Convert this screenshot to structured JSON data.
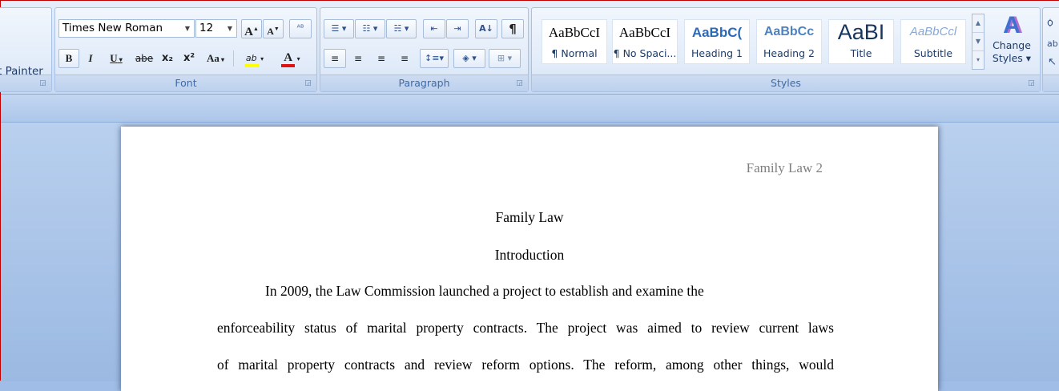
{
  "clipboard": {
    "format_painter_label": "t Painter"
  },
  "font": {
    "group_label": "Font",
    "font_name": "Times New Roman",
    "font_size": "12",
    "grow_label": "A",
    "shrink_label": "A",
    "clear_label": "ᴬᴮ",
    "bold": "B",
    "italic": "I",
    "underline": "U",
    "strike": "abe",
    "subscript": "x₂",
    "superscript": "x²",
    "case": "Aa",
    "highlight": "ab",
    "font_color": "A"
  },
  "paragraph": {
    "group_label": "Paragraph",
    "show_marks": "¶"
  },
  "styles": {
    "group_label": "Styles",
    "items": [
      {
        "sample": "AaBbCcI",
        "name": "¶ Normal",
        "sample_color": "#000000"
      },
      {
        "sample": "AaBbCcI",
        "name": "¶ No Spaci...",
        "sample_color": "#000000"
      },
      {
        "sample": "AaBbC(",
        "name": "Heading 1",
        "sample_color": "#2a6ab8"
      },
      {
        "sample": "AaBbCc",
        "name": "Heading 2",
        "sample_color": "#4f81bd"
      },
      {
        "sample": "AaBI",
        "name": "Title",
        "sample_color": "#17365d"
      },
      {
        "sample": "AaBbCcl",
        "name": "Subtitle",
        "sample_color": "#8aa8d4"
      }
    ],
    "change_styles_label_1": "Change",
    "change_styles_label_2": "Styles ▾"
  },
  "document": {
    "header": "Family Law 2",
    "title": "Family Law",
    "heading": "Introduction",
    "lines": [
      "In 2009, the Law Commission launched a project to establish and examine the",
      "enforceability status of marital property contracts. The project was aimed to review current laws",
      "of marital property contracts and review reform options. The reform, among other things, would"
    ]
  }
}
